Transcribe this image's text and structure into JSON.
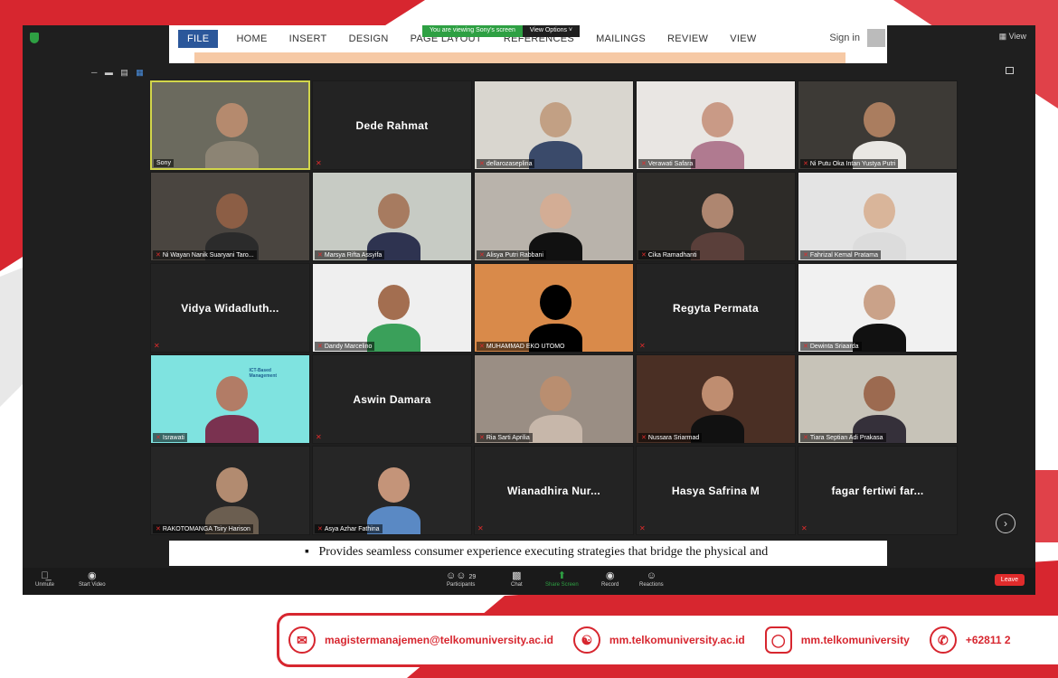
{
  "share": {
    "viewing_text": "You are viewing Sony's screen",
    "view_options": "View Options ˅"
  },
  "top": {
    "view_label": "▦ View"
  },
  "word": {
    "tabs": [
      "FILE",
      "HOME",
      "INSERT",
      "DESIGN",
      "PAGE LAYOUT",
      "REFERENCES",
      "MAILINGS",
      "REVIEW",
      "VIEW"
    ],
    "sign_in": "Sign in",
    "bottom_text": "Provides seamless consumer experience executing strategies that bridge the physical and"
  },
  "participants": [
    {
      "name": "Sony",
      "video": true,
      "active": true
    },
    {
      "name": "Dede Rahmat",
      "video": false
    },
    {
      "name": "dellarozaseplina",
      "video": true
    },
    {
      "name": "Verawati Safara",
      "video": true
    },
    {
      "name": "Ni Putu Oka Intan Yustya Putri",
      "video": true
    },
    {
      "name": "Ni Wayan Nanik Suaryani Taro...",
      "video": true
    },
    {
      "name": "Marsya Rifta Assyifa",
      "video": true
    },
    {
      "name": "Alisya Putri Rabbani",
      "video": true
    },
    {
      "name": "Cika Ramadhanti",
      "video": true
    },
    {
      "name": "Fahrizal Kemal Pratama",
      "video": true
    },
    {
      "name": "Vidya Widadluth...",
      "video": false
    },
    {
      "name": "Dandy Marcelino",
      "video": true
    },
    {
      "name": "MUHAMMAD EKO UTOMO",
      "video": true
    },
    {
      "name": "Regyta Permata",
      "video": false
    },
    {
      "name": "Dewinta Sriaarda",
      "video": true
    },
    {
      "name": "Israwati",
      "video": true
    },
    {
      "name": "Aswin Damara",
      "video": false
    },
    {
      "name": "Ria Sarti Aprilia",
      "video": true
    },
    {
      "name": "Nussara Sriarmad",
      "video": true
    },
    {
      "name": "Tiara Septian Adi Prakasa",
      "video": true
    },
    {
      "name": "RAKOTOMANGA Tsiry Harison",
      "video": true
    },
    {
      "name": "Asya Azhar Fathina",
      "video": true
    },
    {
      "name": "Wianadhira Nur...",
      "video": false
    },
    {
      "name": "Hasya Safrina M",
      "video": false
    },
    {
      "name": "fagar fertiwi far...",
      "video": false
    }
  ],
  "background_text": {
    "ict_logo": "ICT-Based Management"
  },
  "toolbar": {
    "unmute": "Unmute",
    "start_video": "Start Video",
    "participants": "Participants",
    "participants_count": "29",
    "chat": "Chat",
    "share_screen": "Share Screen",
    "record": "Record",
    "reactions": "Reactions",
    "leave": "Leave"
  },
  "contact": {
    "email": "magistermanajemen@telkomuniversity.ac.id",
    "website": "mm.telkomuniversity.ac.id",
    "instagram": "mm.telkomuniversity",
    "phone": "+62811 2"
  },
  "colors": {
    "brand_red": "#d7262f",
    "share_green": "#2ea043",
    "active_border": "#d2d64a"
  }
}
